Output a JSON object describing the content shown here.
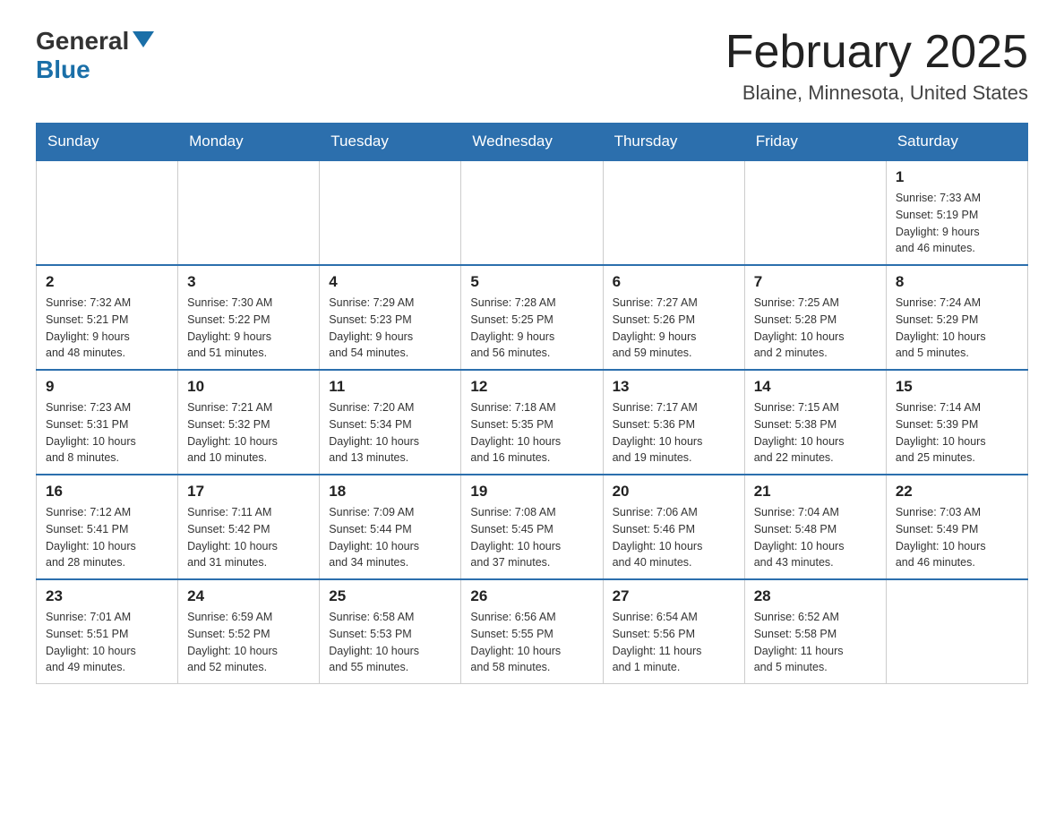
{
  "header": {
    "logo_general": "General",
    "logo_blue": "Blue",
    "title": "February 2025",
    "subtitle": "Blaine, Minnesota, United States"
  },
  "weekdays": [
    "Sunday",
    "Monday",
    "Tuesday",
    "Wednesday",
    "Thursday",
    "Friday",
    "Saturday"
  ],
  "weeks": [
    [
      {
        "day": "",
        "info": ""
      },
      {
        "day": "",
        "info": ""
      },
      {
        "day": "",
        "info": ""
      },
      {
        "day": "",
        "info": ""
      },
      {
        "day": "",
        "info": ""
      },
      {
        "day": "",
        "info": ""
      },
      {
        "day": "1",
        "info": "Sunrise: 7:33 AM\nSunset: 5:19 PM\nDaylight: 9 hours\nand 46 minutes."
      }
    ],
    [
      {
        "day": "2",
        "info": "Sunrise: 7:32 AM\nSunset: 5:21 PM\nDaylight: 9 hours\nand 48 minutes."
      },
      {
        "day": "3",
        "info": "Sunrise: 7:30 AM\nSunset: 5:22 PM\nDaylight: 9 hours\nand 51 minutes."
      },
      {
        "day": "4",
        "info": "Sunrise: 7:29 AM\nSunset: 5:23 PM\nDaylight: 9 hours\nand 54 minutes."
      },
      {
        "day": "5",
        "info": "Sunrise: 7:28 AM\nSunset: 5:25 PM\nDaylight: 9 hours\nand 56 minutes."
      },
      {
        "day": "6",
        "info": "Sunrise: 7:27 AM\nSunset: 5:26 PM\nDaylight: 9 hours\nand 59 minutes."
      },
      {
        "day": "7",
        "info": "Sunrise: 7:25 AM\nSunset: 5:28 PM\nDaylight: 10 hours\nand 2 minutes."
      },
      {
        "day": "8",
        "info": "Sunrise: 7:24 AM\nSunset: 5:29 PM\nDaylight: 10 hours\nand 5 minutes."
      }
    ],
    [
      {
        "day": "9",
        "info": "Sunrise: 7:23 AM\nSunset: 5:31 PM\nDaylight: 10 hours\nand 8 minutes."
      },
      {
        "day": "10",
        "info": "Sunrise: 7:21 AM\nSunset: 5:32 PM\nDaylight: 10 hours\nand 10 minutes."
      },
      {
        "day": "11",
        "info": "Sunrise: 7:20 AM\nSunset: 5:34 PM\nDaylight: 10 hours\nand 13 minutes."
      },
      {
        "day": "12",
        "info": "Sunrise: 7:18 AM\nSunset: 5:35 PM\nDaylight: 10 hours\nand 16 minutes."
      },
      {
        "day": "13",
        "info": "Sunrise: 7:17 AM\nSunset: 5:36 PM\nDaylight: 10 hours\nand 19 minutes."
      },
      {
        "day": "14",
        "info": "Sunrise: 7:15 AM\nSunset: 5:38 PM\nDaylight: 10 hours\nand 22 minutes."
      },
      {
        "day": "15",
        "info": "Sunrise: 7:14 AM\nSunset: 5:39 PM\nDaylight: 10 hours\nand 25 minutes."
      }
    ],
    [
      {
        "day": "16",
        "info": "Sunrise: 7:12 AM\nSunset: 5:41 PM\nDaylight: 10 hours\nand 28 minutes."
      },
      {
        "day": "17",
        "info": "Sunrise: 7:11 AM\nSunset: 5:42 PM\nDaylight: 10 hours\nand 31 minutes."
      },
      {
        "day": "18",
        "info": "Sunrise: 7:09 AM\nSunset: 5:44 PM\nDaylight: 10 hours\nand 34 minutes."
      },
      {
        "day": "19",
        "info": "Sunrise: 7:08 AM\nSunset: 5:45 PM\nDaylight: 10 hours\nand 37 minutes."
      },
      {
        "day": "20",
        "info": "Sunrise: 7:06 AM\nSunset: 5:46 PM\nDaylight: 10 hours\nand 40 minutes."
      },
      {
        "day": "21",
        "info": "Sunrise: 7:04 AM\nSunset: 5:48 PM\nDaylight: 10 hours\nand 43 minutes."
      },
      {
        "day": "22",
        "info": "Sunrise: 7:03 AM\nSunset: 5:49 PM\nDaylight: 10 hours\nand 46 minutes."
      }
    ],
    [
      {
        "day": "23",
        "info": "Sunrise: 7:01 AM\nSunset: 5:51 PM\nDaylight: 10 hours\nand 49 minutes."
      },
      {
        "day": "24",
        "info": "Sunrise: 6:59 AM\nSunset: 5:52 PM\nDaylight: 10 hours\nand 52 minutes."
      },
      {
        "day": "25",
        "info": "Sunrise: 6:58 AM\nSunset: 5:53 PM\nDaylight: 10 hours\nand 55 minutes."
      },
      {
        "day": "26",
        "info": "Sunrise: 6:56 AM\nSunset: 5:55 PM\nDaylight: 10 hours\nand 58 minutes."
      },
      {
        "day": "27",
        "info": "Sunrise: 6:54 AM\nSunset: 5:56 PM\nDaylight: 11 hours\nand 1 minute."
      },
      {
        "day": "28",
        "info": "Sunrise: 6:52 AM\nSunset: 5:58 PM\nDaylight: 11 hours\nand 5 minutes."
      },
      {
        "day": "",
        "info": ""
      }
    ]
  ]
}
